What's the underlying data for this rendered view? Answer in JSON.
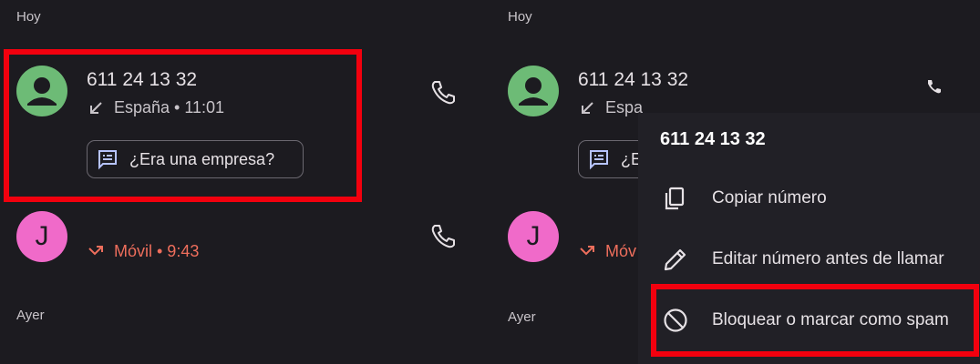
{
  "left": {
    "section_today": "Hoy",
    "section_yesterday": "Ayer",
    "calls": [
      {
        "number": "611 24 13 32",
        "meta": "España • 11:01",
        "direction": "incoming",
        "avatar_color": "#6dbb76"
      },
      {
        "avatar_letter": "J",
        "meta": "Móvil • 9:43",
        "direction": "missed",
        "avatar_color": "#f06ac9"
      }
    ],
    "chip_label": "¿Era una empresa?"
  },
  "right": {
    "section_today": "Hoy",
    "section_yesterday": "Ayer",
    "calls": [
      {
        "number": "611 24 13 32",
        "meta_partial": "Espa"
      },
      {
        "avatar_letter": "J",
        "meta_partial": "Móv"
      }
    ],
    "chip_partial": "¿E"
  },
  "menu": {
    "title": "611 24 13 32",
    "items": [
      {
        "label": "Copiar número",
        "icon": "copy-icon"
      },
      {
        "label": "Editar número antes de llamar",
        "icon": "pencil-icon"
      },
      {
        "label": "Bloquear o marcar como spam",
        "icon": "block-icon"
      }
    ]
  },
  "colors": {
    "highlight": "#f2000e",
    "missed": "#ee6e5c",
    "background": "#1c1b20"
  }
}
